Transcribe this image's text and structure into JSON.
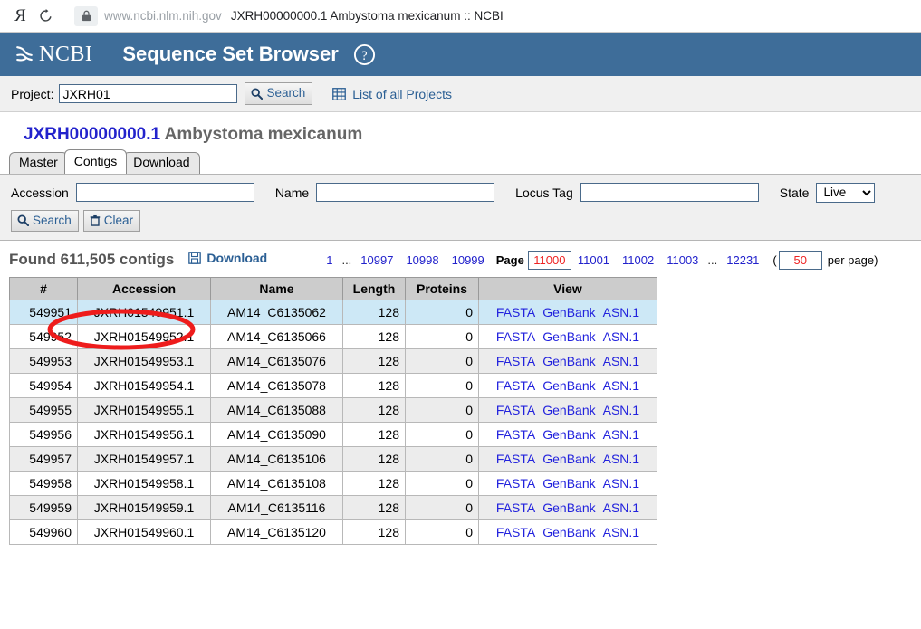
{
  "browser": {
    "back_icon": "yandex-logo",
    "reload_icon": "reload-icon",
    "lock_icon": "lock-icon",
    "url_host": "www.ncbi.nlm.nih.gov",
    "page_title": "JXRH00000000.1 Ambystoma mexicanum :: NCBI"
  },
  "header": {
    "logo_text": "NCBI",
    "app_title": "Sequence Set Browser",
    "help_icon": "question-mark-circle-icon",
    "background_color": "#3e6d99"
  },
  "project_bar": {
    "label": "Project:",
    "input_value": "JXRH01",
    "search_label": "Search",
    "search_icon": "magnifier-icon",
    "list_projects_label": "List of all Projects",
    "list_projects_icon": "grid-table-icon"
  },
  "record": {
    "accession": "JXRH00000000.1",
    "organism": "Ambystoma mexicanum",
    "accession_color": "#2222cc"
  },
  "tabs": [
    {
      "label": "Master",
      "active": false
    },
    {
      "label": "Contigs",
      "active": true
    },
    {
      "label": "Download",
      "active": false
    }
  ],
  "filters": {
    "accession_label": "Accession",
    "accession_value": "",
    "name_label": "Name",
    "name_value": "",
    "locus_tag_label": "Locus Tag",
    "locus_tag_value": "",
    "state_label": "State",
    "state_value": "Live",
    "state_options": [
      "Live"
    ],
    "search_label": "Search",
    "search_icon": "magnifier-icon",
    "clear_label": "Clear",
    "clear_icon": "trash-icon"
  },
  "results": {
    "found_text": "Found 611,505 contigs",
    "download_label": "Download",
    "download_icon": "floppy-disk-icon"
  },
  "pagination": {
    "first_page": "1",
    "ellipsis_left": "...",
    "pages_before": [
      "10997",
      "10998",
      "10999"
    ],
    "page_label": "Page",
    "current_page": "11000",
    "pages_after": [
      "11001",
      "11002",
      "11003"
    ],
    "ellipsis_right": "...",
    "last_page": "12231",
    "open_paren": "(",
    "per_page_value": "50",
    "per_page_label": "per page)",
    "highlight_color": "#ee2222"
  },
  "table": {
    "columns": [
      "#",
      "Accession",
      "Name",
      "Length",
      "Proteins",
      "View"
    ],
    "view_links": [
      "FASTA",
      "GenBank",
      "ASN.1"
    ],
    "rows": [
      {
        "num": "549951",
        "accession": "JXRH01549951.1",
        "name": "AM14_C6135062",
        "length": "128",
        "proteins": "0"
      },
      {
        "num": "549952",
        "accession": "JXRH01549952.1",
        "name": "AM14_C6135066",
        "length": "128",
        "proteins": "0"
      },
      {
        "num": "549953",
        "accession": "JXRH01549953.1",
        "name": "AM14_C6135076",
        "length": "128",
        "proteins": "0"
      },
      {
        "num": "549954",
        "accession": "JXRH01549954.1",
        "name": "AM14_C6135078",
        "length": "128",
        "proteins": "0"
      },
      {
        "num": "549955",
        "accession": "JXRH01549955.1",
        "name": "AM14_C6135088",
        "length": "128",
        "proteins": "0"
      },
      {
        "num": "549956",
        "accession": "JXRH01549956.1",
        "name": "AM14_C6135090",
        "length": "128",
        "proteins": "0"
      },
      {
        "num": "549957",
        "accession": "JXRH01549957.1",
        "name": "AM14_C6135106",
        "length": "128",
        "proteins": "0"
      },
      {
        "num": "549958",
        "accession": "JXRH01549958.1",
        "name": "AM14_C6135108",
        "length": "128",
        "proteins": "0"
      },
      {
        "num": "549959",
        "accession": "JXRH01549959.1",
        "name": "AM14_C6135116",
        "length": "128",
        "proteins": "0"
      },
      {
        "num": "549960",
        "accession": "JXRH01549960.1",
        "name": "AM14_C6135120",
        "length": "128",
        "proteins": "0"
      }
    ]
  },
  "annotation": {
    "type": "ellipse-highlight",
    "target": "JXRH01549951.1",
    "color": "#ee1c1c"
  }
}
